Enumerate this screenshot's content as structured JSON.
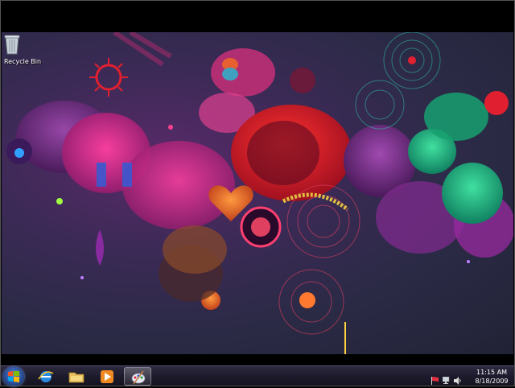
{
  "desktop": {
    "icons": [
      {
        "label": "Recycle Bin",
        "icon": "recycle-bin-icon"
      }
    ]
  },
  "taskbar": {
    "start_icon": "windows-logo-icon",
    "items": [
      {
        "icon": "internet-explorer-icon",
        "state": "pinned"
      },
      {
        "icon": "folder-icon",
        "state": "pinned"
      },
      {
        "icon": "media-player-icon",
        "state": "pinned"
      },
      {
        "icon": "paint-icon",
        "state": "active"
      }
    ],
    "tray": {
      "icons": [
        "action-center-flag-icon",
        "network-icon",
        "volume-icon"
      ],
      "time": "11:15 AM",
      "date": "8/18/2009"
    }
  },
  "colors": {
    "wallpaper_base": "#2a2a45",
    "taskbar": "#1d1a2c",
    "accent_magenta": "#e0207a",
    "accent_red": "#e02030",
    "accent_green": "#20c080"
  }
}
